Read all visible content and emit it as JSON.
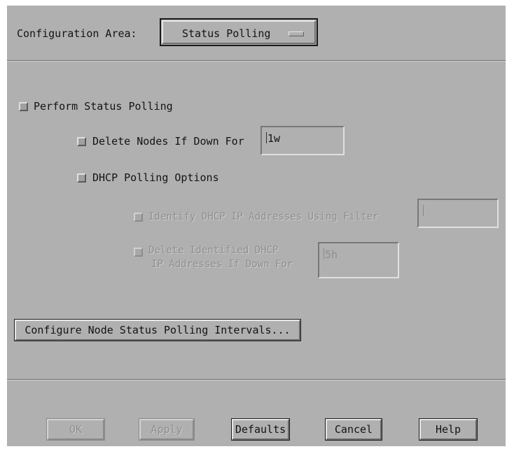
{
  "config_area": {
    "label": "Configuration Area:",
    "selected": "Status Polling"
  },
  "status_polling": {
    "perform_label": "Perform Status Polling",
    "delete_nodes_label": "Delete Nodes If Down For",
    "delete_nodes_value": "1w",
    "dhcp_options_label": "DHCP Polling Options",
    "identify_dhcp_label": "Identify DHCP IP Addresses Using Filter",
    "identify_dhcp_value": "",
    "delete_dhcp_label_line1": "Delete Identified DHCP",
    "delete_dhcp_label_line2": "IP Addresses If Down For",
    "delete_dhcp_value": "5h"
  },
  "intervals_button": "Configure Node Status Polling Intervals...",
  "footer": {
    "ok": "OK",
    "apply": "Apply",
    "defaults": "Defaults",
    "cancel": "Cancel",
    "help": "Help"
  }
}
